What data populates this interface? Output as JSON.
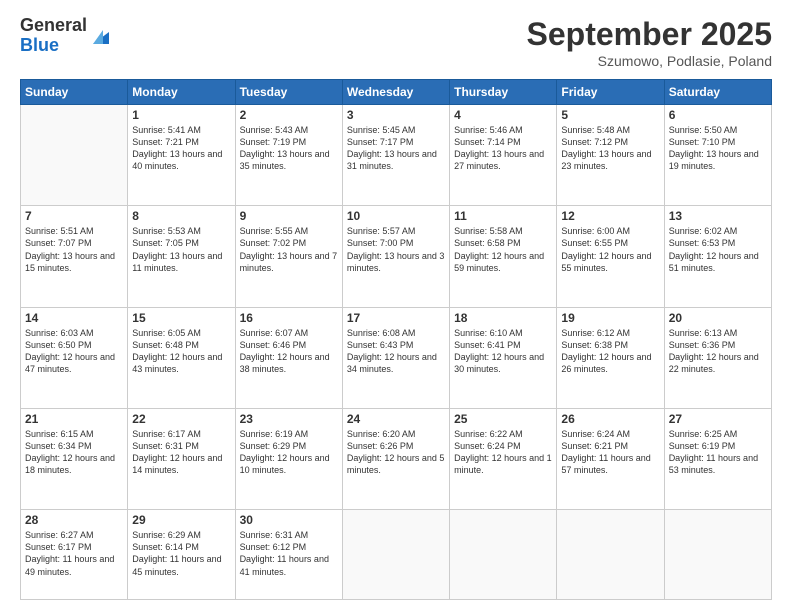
{
  "logo": {
    "general": "General",
    "blue": "Blue"
  },
  "title": "September 2025",
  "location": "Szumowo, Podlasie, Poland",
  "weekdays": [
    "Sunday",
    "Monday",
    "Tuesday",
    "Wednesday",
    "Thursday",
    "Friday",
    "Saturday"
  ],
  "weeks": [
    [
      {
        "day": "",
        "sunrise": "",
        "sunset": "",
        "daylight": ""
      },
      {
        "day": "1",
        "sunrise": "Sunrise: 5:41 AM",
        "sunset": "Sunset: 7:21 PM",
        "daylight": "Daylight: 13 hours and 40 minutes."
      },
      {
        "day": "2",
        "sunrise": "Sunrise: 5:43 AM",
        "sunset": "Sunset: 7:19 PM",
        "daylight": "Daylight: 13 hours and 35 minutes."
      },
      {
        "day": "3",
        "sunrise": "Sunrise: 5:45 AM",
        "sunset": "Sunset: 7:17 PM",
        "daylight": "Daylight: 13 hours and 31 minutes."
      },
      {
        "day": "4",
        "sunrise": "Sunrise: 5:46 AM",
        "sunset": "Sunset: 7:14 PM",
        "daylight": "Daylight: 13 hours and 27 minutes."
      },
      {
        "day": "5",
        "sunrise": "Sunrise: 5:48 AM",
        "sunset": "Sunset: 7:12 PM",
        "daylight": "Daylight: 13 hours and 23 minutes."
      },
      {
        "day": "6",
        "sunrise": "Sunrise: 5:50 AM",
        "sunset": "Sunset: 7:10 PM",
        "daylight": "Daylight: 13 hours and 19 minutes."
      }
    ],
    [
      {
        "day": "7",
        "sunrise": "Sunrise: 5:51 AM",
        "sunset": "Sunset: 7:07 PM",
        "daylight": "Daylight: 13 hours and 15 minutes."
      },
      {
        "day": "8",
        "sunrise": "Sunrise: 5:53 AM",
        "sunset": "Sunset: 7:05 PM",
        "daylight": "Daylight: 13 hours and 11 minutes."
      },
      {
        "day": "9",
        "sunrise": "Sunrise: 5:55 AM",
        "sunset": "Sunset: 7:02 PM",
        "daylight": "Daylight: 13 hours and 7 minutes."
      },
      {
        "day": "10",
        "sunrise": "Sunrise: 5:57 AM",
        "sunset": "Sunset: 7:00 PM",
        "daylight": "Daylight: 13 hours and 3 minutes."
      },
      {
        "day": "11",
        "sunrise": "Sunrise: 5:58 AM",
        "sunset": "Sunset: 6:58 PM",
        "daylight": "Daylight: 12 hours and 59 minutes."
      },
      {
        "day": "12",
        "sunrise": "Sunrise: 6:00 AM",
        "sunset": "Sunset: 6:55 PM",
        "daylight": "Daylight: 12 hours and 55 minutes."
      },
      {
        "day": "13",
        "sunrise": "Sunrise: 6:02 AM",
        "sunset": "Sunset: 6:53 PM",
        "daylight": "Daylight: 12 hours and 51 minutes."
      }
    ],
    [
      {
        "day": "14",
        "sunrise": "Sunrise: 6:03 AM",
        "sunset": "Sunset: 6:50 PM",
        "daylight": "Daylight: 12 hours and 47 minutes."
      },
      {
        "day": "15",
        "sunrise": "Sunrise: 6:05 AM",
        "sunset": "Sunset: 6:48 PM",
        "daylight": "Daylight: 12 hours and 43 minutes."
      },
      {
        "day": "16",
        "sunrise": "Sunrise: 6:07 AM",
        "sunset": "Sunset: 6:46 PM",
        "daylight": "Daylight: 12 hours and 38 minutes."
      },
      {
        "day": "17",
        "sunrise": "Sunrise: 6:08 AM",
        "sunset": "Sunset: 6:43 PM",
        "daylight": "Daylight: 12 hours and 34 minutes."
      },
      {
        "day": "18",
        "sunrise": "Sunrise: 6:10 AM",
        "sunset": "Sunset: 6:41 PM",
        "daylight": "Daylight: 12 hours and 30 minutes."
      },
      {
        "day": "19",
        "sunrise": "Sunrise: 6:12 AM",
        "sunset": "Sunset: 6:38 PM",
        "daylight": "Daylight: 12 hours and 26 minutes."
      },
      {
        "day": "20",
        "sunrise": "Sunrise: 6:13 AM",
        "sunset": "Sunset: 6:36 PM",
        "daylight": "Daylight: 12 hours and 22 minutes."
      }
    ],
    [
      {
        "day": "21",
        "sunrise": "Sunrise: 6:15 AM",
        "sunset": "Sunset: 6:34 PM",
        "daylight": "Daylight: 12 hours and 18 minutes."
      },
      {
        "day": "22",
        "sunrise": "Sunrise: 6:17 AM",
        "sunset": "Sunset: 6:31 PM",
        "daylight": "Daylight: 12 hours and 14 minutes."
      },
      {
        "day": "23",
        "sunrise": "Sunrise: 6:19 AM",
        "sunset": "Sunset: 6:29 PM",
        "daylight": "Daylight: 12 hours and 10 minutes."
      },
      {
        "day": "24",
        "sunrise": "Sunrise: 6:20 AM",
        "sunset": "Sunset: 6:26 PM",
        "daylight": "Daylight: 12 hours and 5 minutes."
      },
      {
        "day": "25",
        "sunrise": "Sunrise: 6:22 AM",
        "sunset": "Sunset: 6:24 PM",
        "daylight": "Daylight: 12 hours and 1 minute."
      },
      {
        "day": "26",
        "sunrise": "Sunrise: 6:24 AM",
        "sunset": "Sunset: 6:21 PM",
        "daylight": "Daylight: 11 hours and 57 minutes."
      },
      {
        "day": "27",
        "sunrise": "Sunrise: 6:25 AM",
        "sunset": "Sunset: 6:19 PM",
        "daylight": "Daylight: 11 hours and 53 minutes."
      }
    ],
    [
      {
        "day": "28",
        "sunrise": "Sunrise: 6:27 AM",
        "sunset": "Sunset: 6:17 PM",
        "daylight": "Daylight: 11 hours and 49 minutes."
      },
      {
        "day": "29",
        "sunrise": "Sunrise: 6:29 AM",
        "sunset": "Sunset: 6:14 PM",
        "daylight": "Daylight: 11 hours and 45 minutes."
      },
      {
        "day": "30",
        "sunrise": "Sunrise: 6:31 AM",
        "sunset": "Sunset: 6:12 PM",
        "daylight": "Daylight: 11 hours and 41 minutes."
      },
      {
        "day": "",
        "sunrise": "",
        "sunset": "",
        "daylight": ""
      },
      {
        "day": "",
        "sunrise": "",
        "sunset": "",
        "daylight": ""
      },
      {
        "day": "",
        "sunrise": "",
        "sunset": "",
        "daylight": ""
      },
      {
        "day": "",
        "sunrise": "",
        "sunset": "",
        "daylight": ""
      }
    ]
  ]
}
